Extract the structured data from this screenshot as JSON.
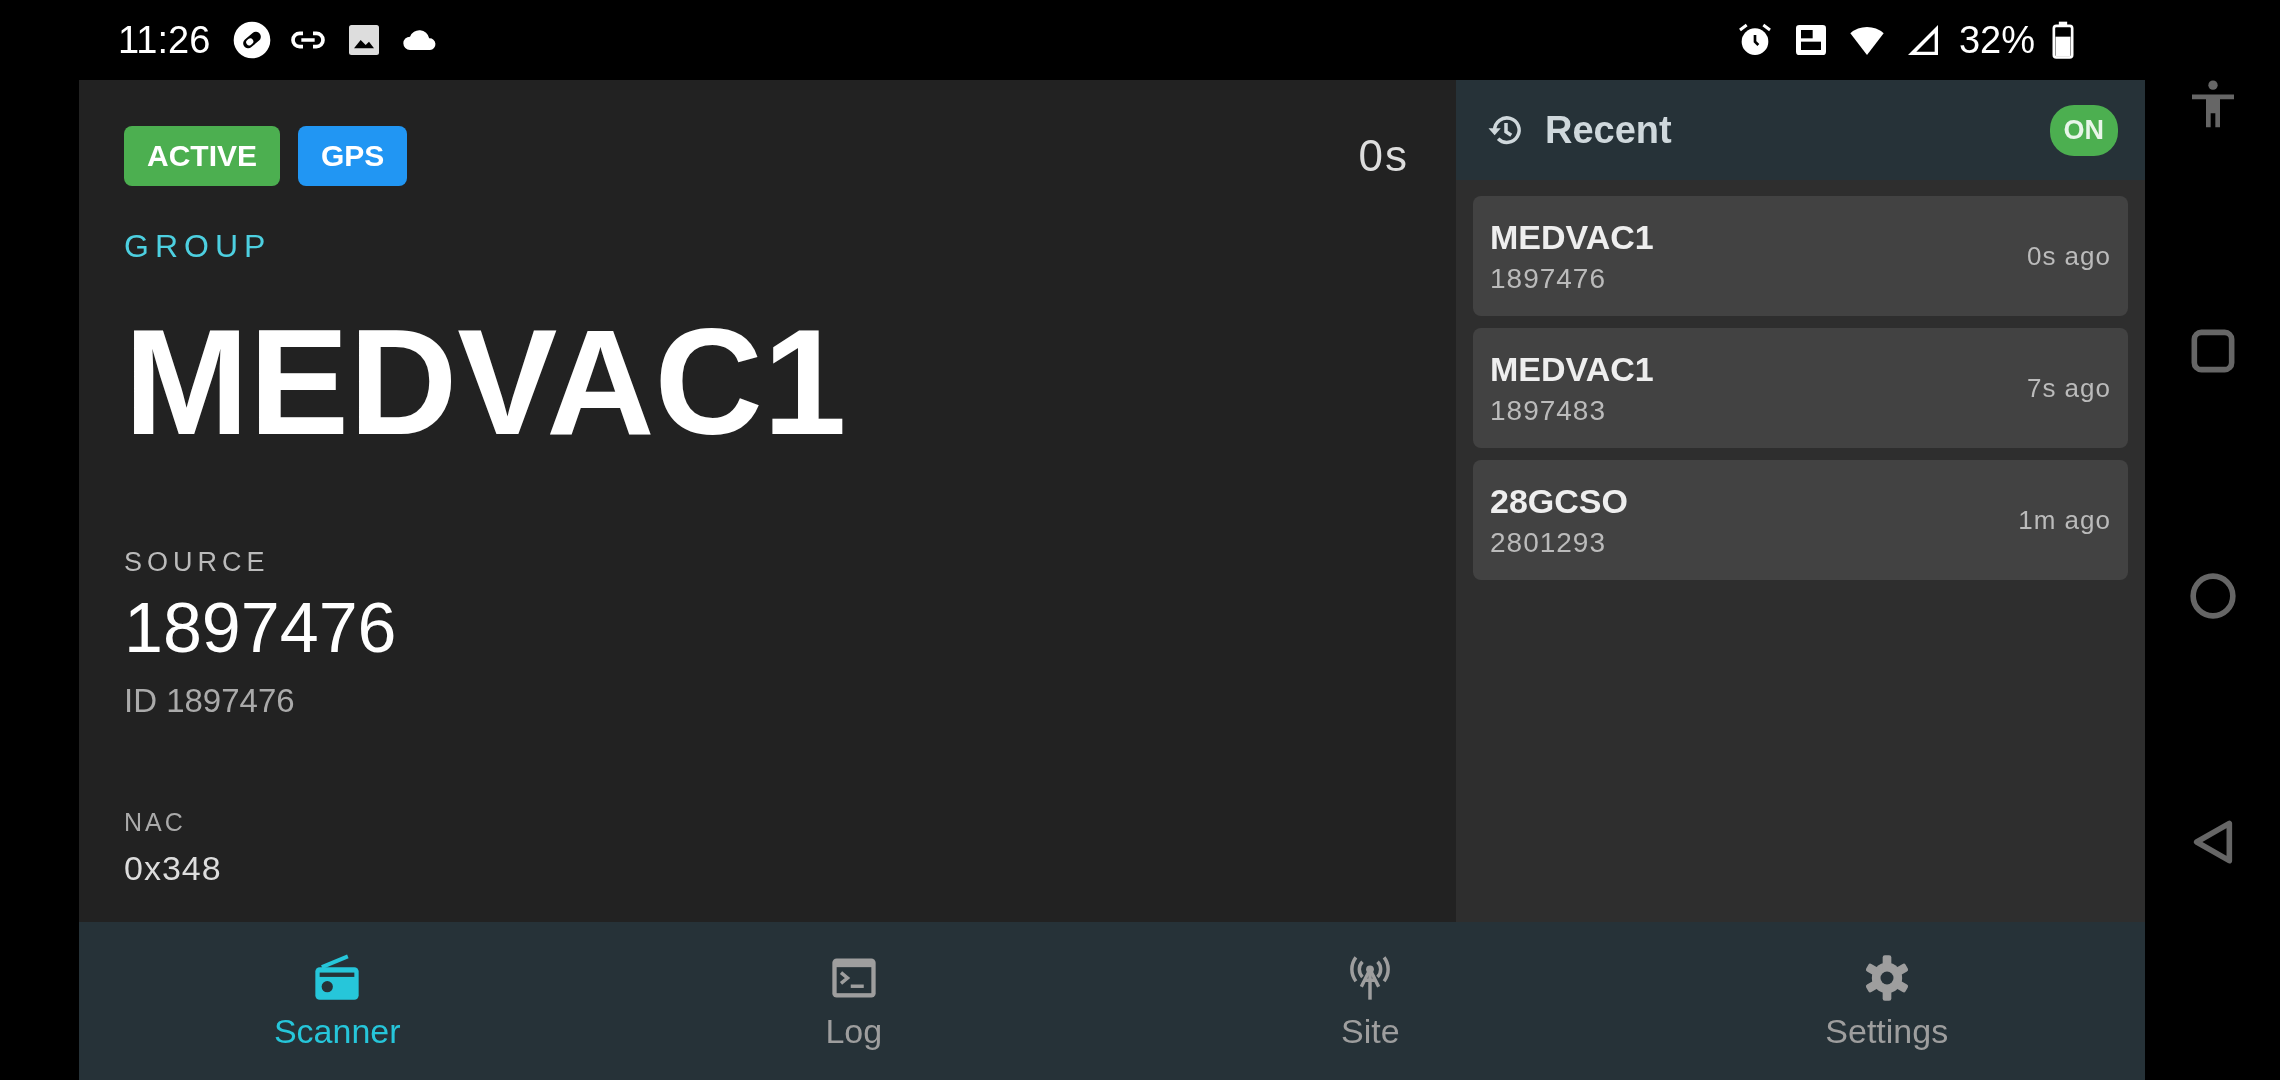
{
  "status_bar": {
    "time": "11:26",
    "battery": "32%"
  },
  "badges": [
    {
      "label": "ACTIVE",
      "color": "#4caf50"
    },
    {
      "label": "GPS",
      "color": "#2196f3"
    }
  ],
  "elapsed": "0s",
  "group": {
    "label": "GROUP",
    "name": "MEDVAC1"
  },
  "source": {
    "label": "SOURCE",
    "value": "1897476",
    "id": "ID 1897476"
  },
  "nac": {
    "label": "NAC",
    "value": "0x348"
  },
  "recent": {
    "title": "Recent",
    "toggle": {
      "label": "ON",
      "on": true
    },
    "items": [
      {
        "name": "MEDVAC1",
        "id": "1897476",
        "time": "0s ago"
      },
      {
        "name": "MEDVAC1",
        "id": "1897483",
        "time": "7s ago"
      },
      {
        "name": "28GCSO",
        "id": "2801293",
        "time": "1m ago"
      }
    ]
  },
  "nav": [
    {
      "kind": "radio",
      "label": "Scanner",
      "selected": true
    },
    {
      "kind": "terminal",
      "label": "Log",
      "selected": false
    },
    {
      "kind": "antenna",
      "label": "Site",
      "selected": false
    },
    {
      "kind": "gear",
      "label": "Settings",
      "selected": false
    }
  ]
}
